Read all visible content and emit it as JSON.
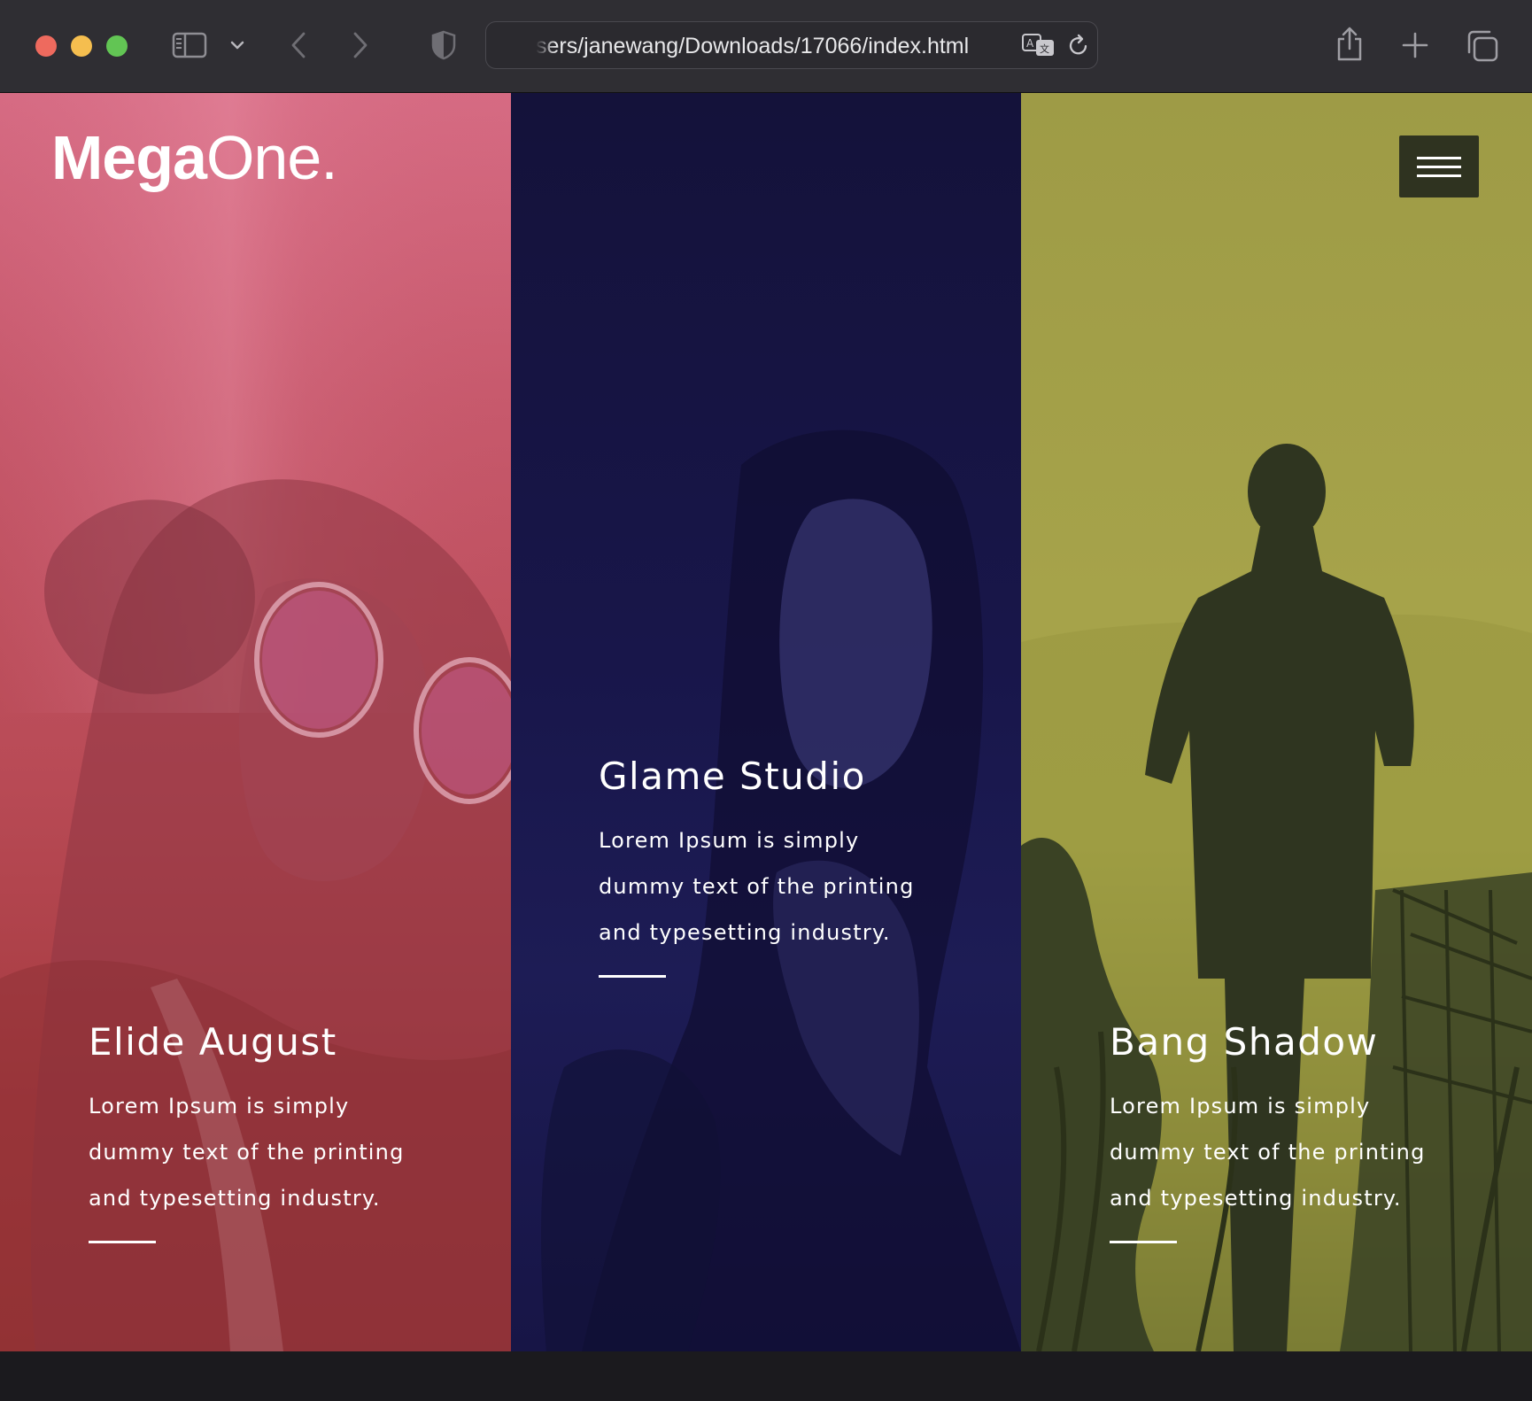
{
  "browser": {
    "url": "sers/janewang/Downloads/17066/index.html",
    "icons": {
      "sidebar": "sidebar-icon",
      "chevron": "chevron-down-icon",
      "back": "chevron-left-icon",
      "forward": "chevron-right-icon",
      "privacy": "shield-icon",
      "translate": "translate-icon",
      "reload": "reload-icon",
      "share": "share-icon",
      "new_tab": "plus-icon",
      "tabs": "tabs-icon"
    }
  },
  "site": {
    "logo_bold": "Mega",
    "logo_light": "One."
  },
  "panels": [
    {
      "title": "Elide August",
      "text": "Lorem Ipsum is simply dummy text of the printing and typesetting industry.",
      "tint": "#b84a55"
    },
    {
      "title": "Glame Studio",
      "text": "Lorem Ipsum is simply dummy text of the printing and typesetting industry.",
      "tint": "#18164a"
    },
    {
      "title": "Bang Shadow",
      "text": "Lorem Ipsum is simply dummy text of the printing and typesetting industry.",
      "tint": "#a6a34a"
    }
  ],
  "colors": {
    "menu_button": "#2f3320",
    "chrome": "#2f2e33"
  }
}
